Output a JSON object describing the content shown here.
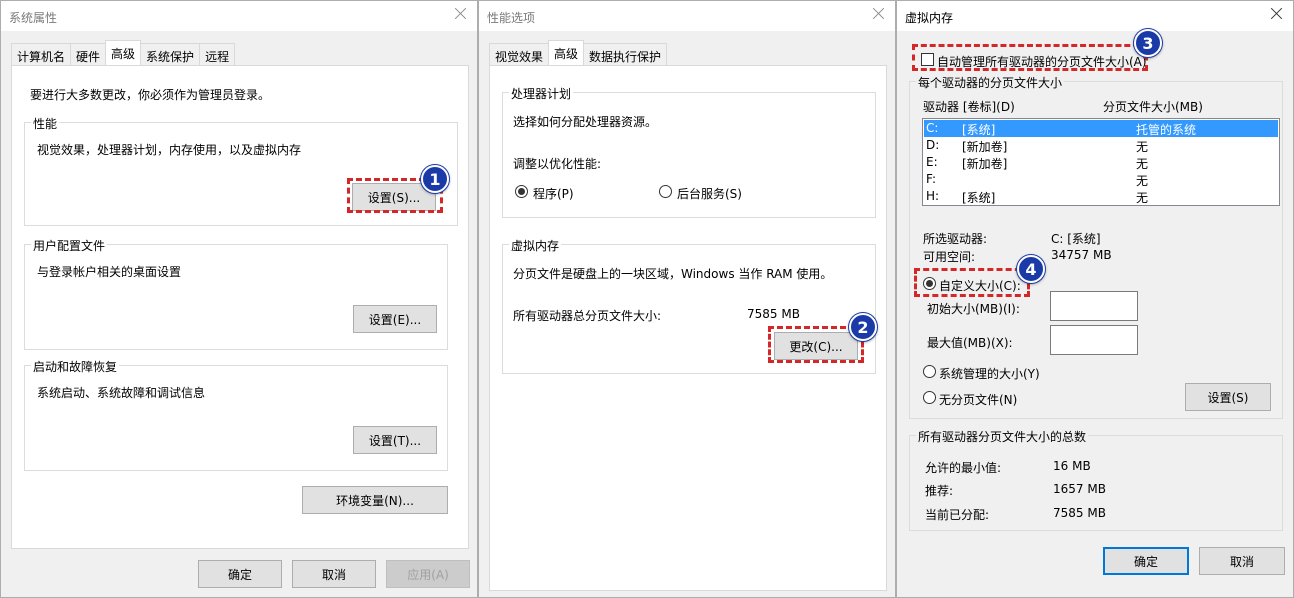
{
  "win1": {
    "title": "系统属性",
    "tabs": [
      "计算机名",
      "硬件",
      "高级",
      "系统保护",
      "远程"
    ],
    "notice": "要进行大多数更改，你必须作为管理员登录。",
    "performance": {
      "label": "性能",
      "desc": "视觉效果，处理器计划，内存使用，以及虚拟内存",
      "button": "设置(S)..."
    },
    "profiles": {
      "label": "用户配置文件",
      "desc": "与登录帐户相关的桌面设置",
      "button": "设置(E)..."
    },
    "startup": {
      "label": "启动和故障恢复",
      "desc": "系统启动、系统故障和调试信息",
      "button": "设置(T)..."
    },
    "env_button": "环境变量(N)...",
    "ok": "确定",
    "cancel": "取消",
    "apply": "应用(A)"
  },
  "win2": {
    "title": "性能选项",
    "tabs": [
      "视觉效果",
      "高级",
      "数据执行保护"
    ],
    "scheduling": {
      "label": "处理器计划",
      "desc": "选择如何分配处理器资源。",
      "optimize": "调整以优化性能:",
      "programs": "程序(P)",
      "services": "后台服务(S)",
      "selected": "programs"
    },
    "vm": {
      "label": "虚拟内存",
      "desc": "分页文件是硬盘上的一块区域，Windows 当作 RAM 使用。",
      "total_label": "所有驱动器总分页文件大小:",
      "total_value": "7585 MB",
      "change_button": "更改(C)..."
    }
  },
  "win3": {
    "title": "虚拟内存",
    "auto_manage": "自动管理所有驱动器的分页文件大小(A)",
    "auto_checked": false,
    "per_drive_label": "每个驱动器的分页文件大小",
    "col_drive": "驱动器 [卷标](D)",
    "col_size": "分页文件大小(MB)",
    "drives": [
      {
        "letter": "C:",
        "label": "[系统]",
        "size": "托管的系统",
        "selected": true
      },
      {
        "letter": "D:",
        "label": "[新加卷]",
        "size": "无",
        "selected": false
      },
      {
        "letter": "E:",
        "label": "[新加卷]",
        "size": "无",
        "selected": false
      },
      {
        "letter": "F:",
        "label": "",
        "size": "无",
        "selected": false
      },
      {
        "letter": "H:",
        "label": "[系统]",
        "size": "无",
        "selected": false
      }
    ],
    "selected_drive_label": "所选驱动器:",
    "selected_drive_value": "C:  [系统]",
    "free_space_label": "可用空间:",
    "free_space_value": "34757 MB",
    "custom_size": "自定义大小(C):",
    "initial_size": "初始大小(MB)(I):",
    "max_size": "最大值(MB)(X):",
    "initial_value": "",
    "max_value": "",
    "system_managed": "系统管理的大小(Y)",
    "no_paging": "无分页文件(N)",
    "set_button": "设置(S)",
    "totals_label": "所有驱动器分页文件大小的总数",
    "min_label": "允许的最小值:",
    "min_value": "16 MB",
    "recommended_label": "推荐:",
    "recommended_value": "1657 MB",
    "allocated_label": "当前已分配:",
    "allocated_value": "7585 MB",
    "ok": "确定",
    "cancel": "取消"
  },
  "badges": [
    "1",
    "2",
    "3",
    "4"
  ],
  "colors": {
    "callout": "#d42727",
    "badge": "#1a3aa8",
    "selection": "#3399ff",
    "accent_border": "#0078d7"
  }
}
